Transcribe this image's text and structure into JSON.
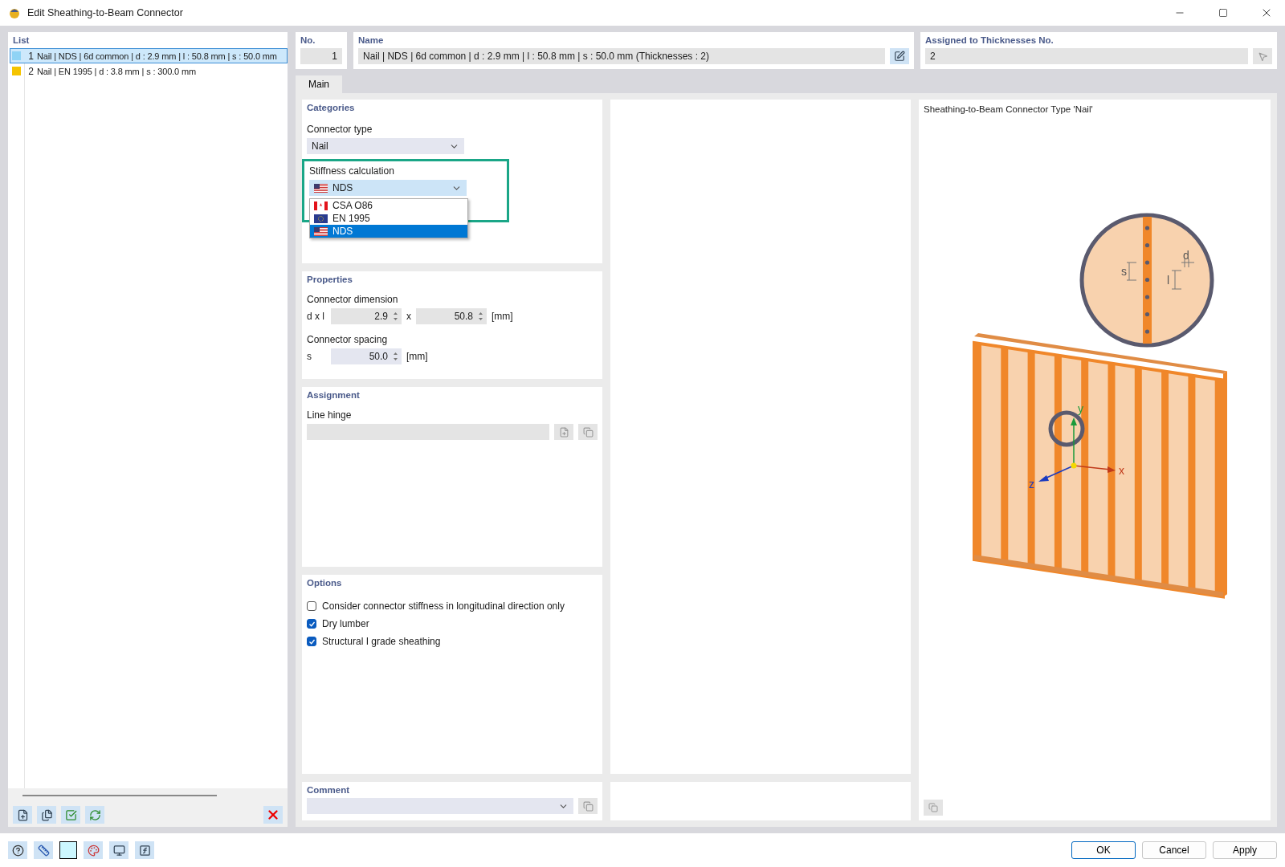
{
  "window": {
    "title": "Edit Sheathing-to-Beam Connector"
  },
  "list": {
    "title": "List",
    "items": [
      {
        "number": "1",
        "label": "Nail | NDS | 6d common | d : 2.9 mm | l : 50.8 mm | s : 50.0 mm",
        "color": "#8fd3f5",
        "selected": true
      },
      {
        "number": "2",
        "label": "Nail | EN 1995 | d : 3.8 mm | s : 300.0 mm",
        "color": "#f5c400",
        "selected": false
      }
    ]
  },
  "header": {
    "no": {
      "label": "No.",
      "value": "1"
    },
    "name": {
      "label": "Name",
      "value": "Nail | NDS | 6d common | d : 2.9 mm | l : 50.8 mm | s : 50.0 mm (Thicknesses : 2)"
    },
    "assigned": {
      "label": "Assigned to Thicknesses No.",
      "value": "2"
    }
  },
  "tabs": [
    {
      "label": "Main",
      "selected": true
    }
  ],
  "categories": {
    "title": "Categories",
    "connector_type": {
      "label": "Connector type",
      "value": "Nail"
    },
    "stiffness": {
      "label": "Stiffness calculation",
      "value": "NDS",
      "expanded": true,
      "highlighted": true,
      "options": [
        {
          "label": "CSA O86",
          "kind": "canada",
          "selected": false
        },
        {
          "label": "EN 1995",
          "kind": "europe",
          "selected": false
        },
        {
          "label": "NDS",
          "kind": "usa",
          "selected": true
        }
      ]
    }
  },
  "properties": {
    "title": "Properties",
    "dimension": {
      "label": "Connector dimension",
      "symbol": "d x l",
      "d": "2.9",
      "separator": "x",
      "l": "50.8",
      "unit": "[mm]"
    },
    "spacing": {
      "label": "Connector spacing",
      "symbol": "s",
      "value": "50.0",
      "unit": "[mm]"
    }
  },
  "assignment": {
    "title": "Assignment",
    "line_hinge": {
      "label": "Line hinge"
    }
  },
  "options": {
    "title": "Options",
    "items": [
      {
        "label": "Consider connector stiffness in longitudinal direction only",
        "checked": false
      },
      {
        "label": "Dry lumber",
        "checked": true
      },
      {
        "label": "Structural I grade sheathing",
        "checked": true
      }
    ]
  },
  "comment": {
    "label": "Comment"
  },
  "diagram": {
    "title": "Sheathing-to-Beam Connector Type 'Nail'",
    "detail_labels": {
      "spacing": "s",
      "diameter": "d",
      "length": "l"
    },
    "axes": {
      "x": "x",
      "y": "y",
      "z": "z"
    }
  },
  "buttons": [
    {
      "label": "OK",
      "default": true
    },
    {
      "label": "Cancel",
      "default": false
    },
    {
      "label": "Apply",
      "default": false
    }
  ]
}
